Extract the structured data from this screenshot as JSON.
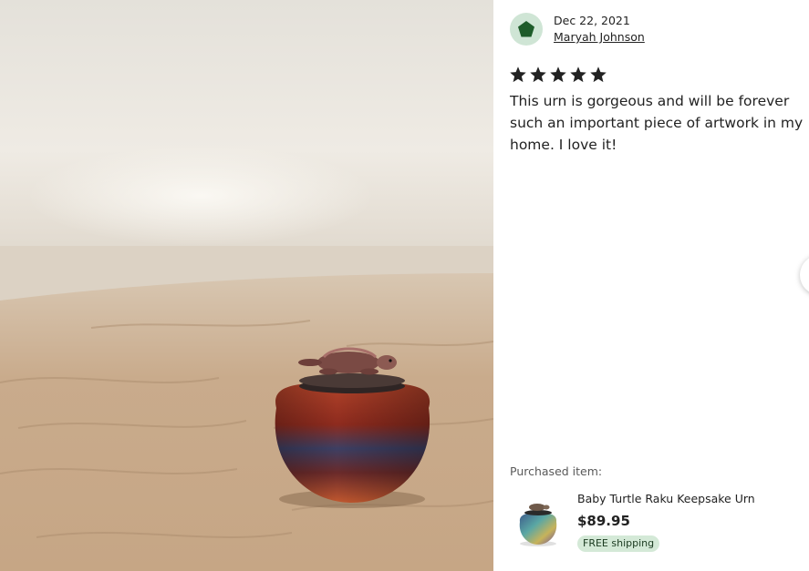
{
  "photo": {
    "icon": "turtle-urn-on-beach-photo"
  },
  "review": {
    "avatar_icon": "green-pentagon-icon",
    "date": "Dec 22, 2021",
    "author": "Maryah Johnson",
    "rating": 5,
    "rating_max": 5,
    "text": "This urn is gorgeous and will be forever such an important piece of artwork in my home. I love it!"
  },
  "purchased": {
    "label": "Purchased item:",
    "title": "Baby Turtle Raku Keepsake Urn",
    "price": "$89.95",
    "shipping_badge": "FREE shipping"
  },
  "colors": {
    "avatar_bg": "#cfe5d5",
    "avatar_shape": "#1e5c2a",
    "star": "#222222",
    "badge_bg": "#d4e9d7"
  }
}
